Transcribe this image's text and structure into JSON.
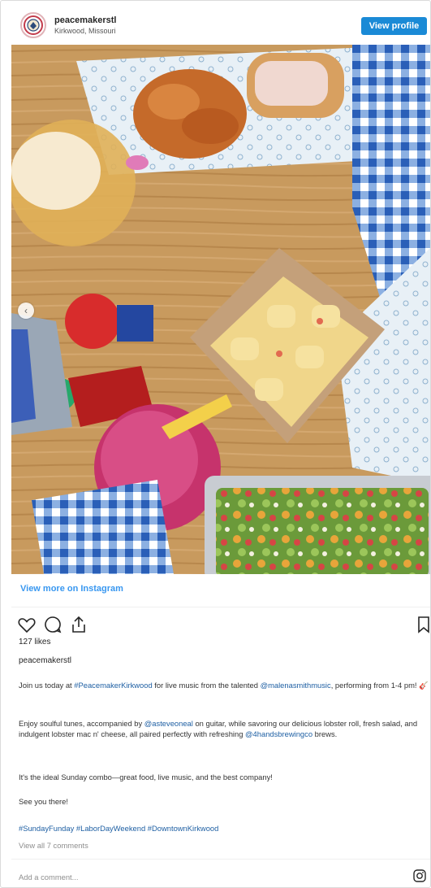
{
  "header": {
    "username": "peacemakerstl",
    "location": "Kirkwood, Missouri",
    "view_profile_label": "View profile"
  },
  "footer": {
    "view_more_label": "View more on Instagram",
    "likes": "127 likes",
    "poster": "peacemakerstl",
    "caption": {
      "p1_a": "Join us today at ",
      "p1_tag": "#PeacemakerKirkwood",
      "p1_b": " for live music from the talented ",
      "p1_mention": "@malenasmithmusic",
      "p1_c": ", performing from 1-4 pm! 🎸",
      "p2_a": "Enjoy soulful tunes, accompanied by ",
      "p2_mention": "@asteveoneal",
      "p2_b": " on guitar, while savoring our delicious lobster roll, fresh salad, and indulgent lobster mac n' cheese, all paired perfectly with refreshing ",
      "p2_mention2": "@4handsbrewingco",
      "p2_c": " brews.",
      "p3": "It's the ideal Sunday combo—great food, live music, and the best company!",
      "p4": "See you there!",
      "p5": "#SundayFunday #LaborDayWeekend #DowntownKirkwood"
    },
    "view_all_comments": "View all 7 comments",
    "add_comment_placeholder": "Add a comment..."
  },
  "icons": {
    "heart": "heart-icon",
    "comment": "comment-icon",
    "share": "share-icon",
    "bookmark": "bookmark-icon",
    "instagram": "instagram-icon",
    "carousel_prev": "chevron-left-icon"
  },
  "colors": {
    "accent": "#1a8ad6",
    "link": "#3897f0",
    "hashtag": "#1e5fa3"
  }
}
